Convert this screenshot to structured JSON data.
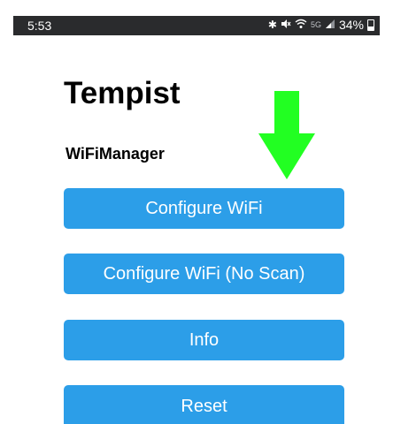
{
  "status_bar": {
    "time": "5:53",
    "icons": [
      "bluetooth-icon",
      "mute-icon",
      "wifi-icon",
      "5g-icon",
      "signal-icon",
      "battery-icon"
    ],
    "network_label": "5G",
    "battery_text": "34%",
    "battery_level": 0.34
  },
  "page": {
    "title": "Tempist",
    "subtitle": "WiFiManager"
  },
  "buttons": [
    {
      "label": "Configure WiFi"
    },
    {
      "label": "Configure WiFi (No Scan)"
    },
    {
      "label": "Info"
    },
    {
      "label": "Reset"
    }
  ],
  "colors": {
    "button_bg": "#2c9ee8",
    "arrow": "#22ff22",
    "status_bar_bg": "#2a2b2d"
  }
}
